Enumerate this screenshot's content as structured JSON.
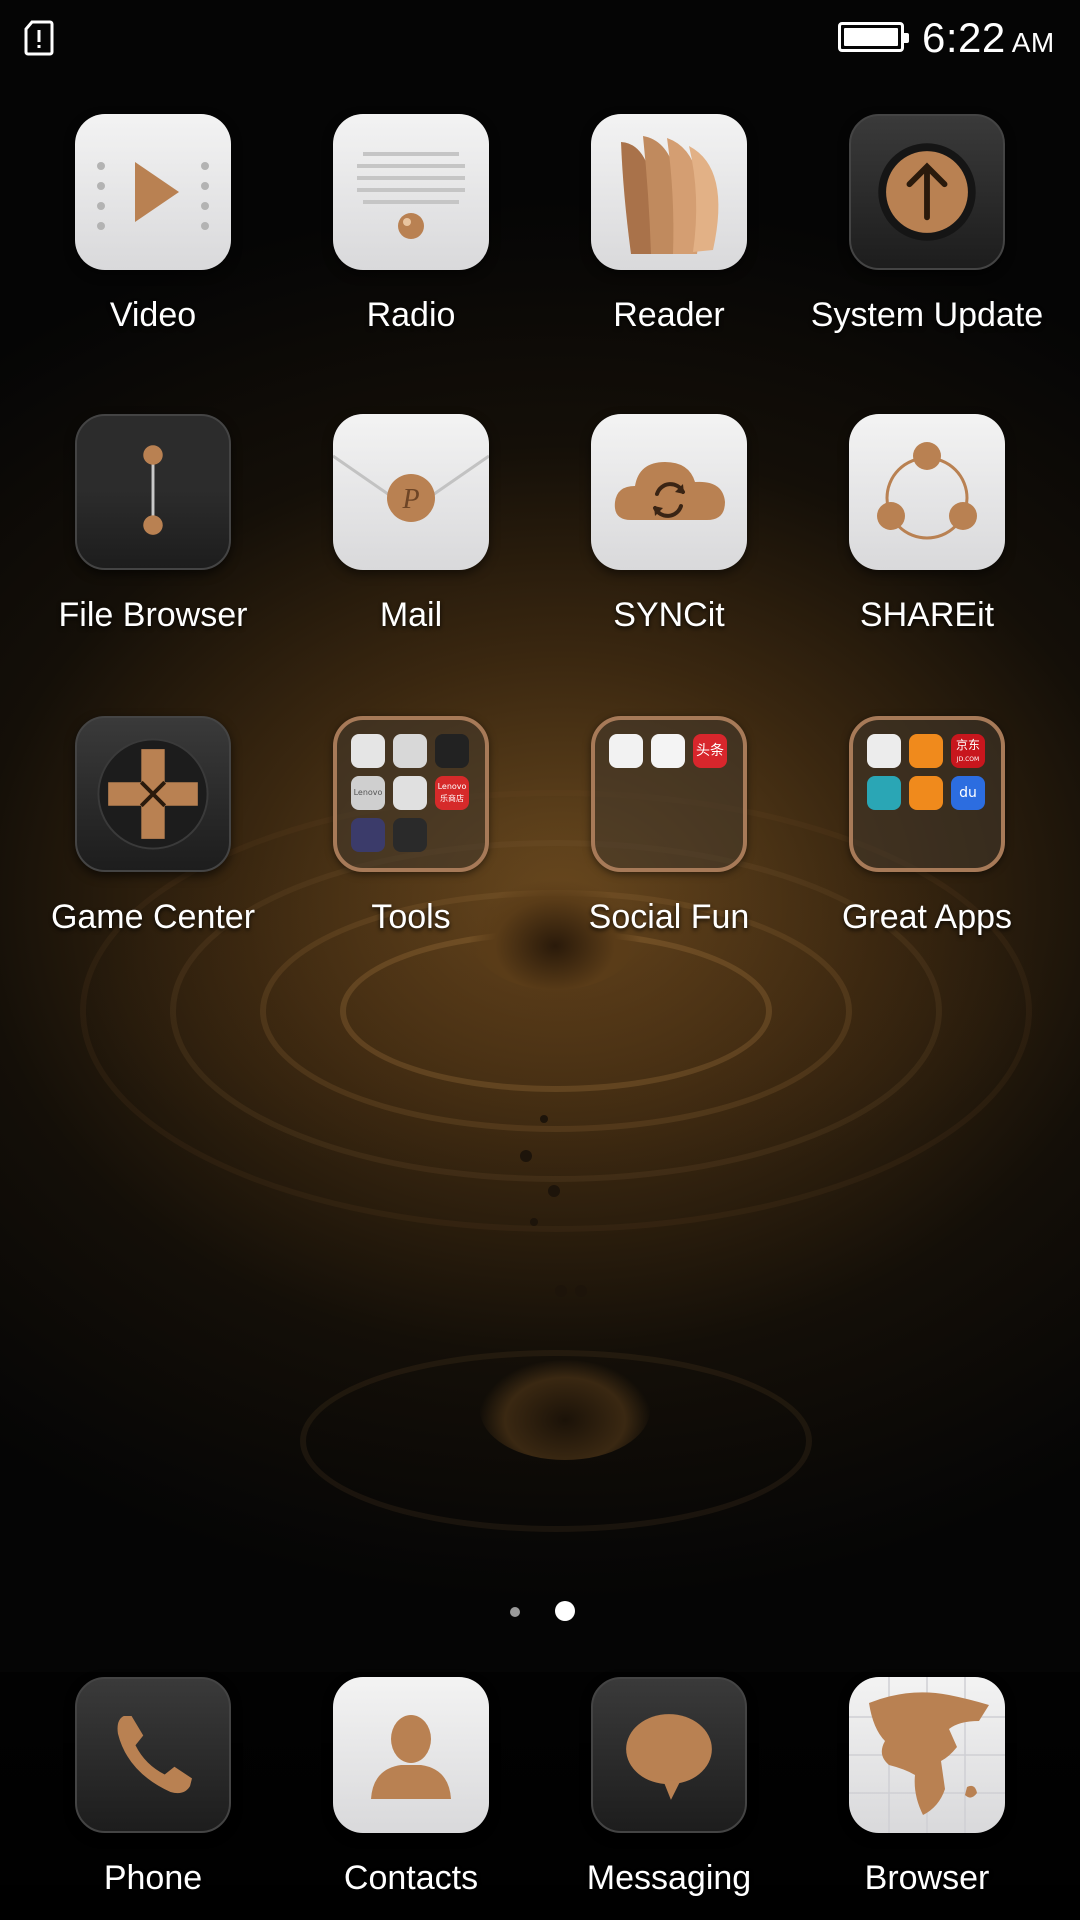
{
  "status_bar": {
    "sim_icon": "sim-alert-icon",
    "battery_icon": "battery-full-icon",
    "time": "6:22",
    "ampm": "AM"
  },
  "apps": [
    {
      "label": "Video",
      "icon": "video-play-icon"
    },
    {
      "label": "Radio",
      "icon": "radio-speaker-icon"
    },
    {
      "label": "Reader",
      "icon": "reader-pages-icon"
    },
    {
      "label": "System Update",
      "icon": "update-arrow-icon"
    },
    {
      "label": "File Browser",
      "icon": "file-browser-icon"
    },
    {
      "label": "Mail",
      "icon": "mail-envelope-icon"
    },
    {
      "label": "SYNCit",
      "icon": "sync-cloud-icon"
    },
    {
      "label": "SHAREit",
      "icon": "share-nodes-icon"
    },
    {
      "label": "Game Center",
      "icon": "gamepad-icon"
    }
  ],
  "folders": [
    {
      "label": "Tools",
      "icon": "tools-folder-icon",
      "mini_labels": [
        "Lenovo",
        "Lenovo",
        "乐商店"
      ]
    },
    {
      "label": "Social Fun",
      "icon": "social-folder-icon",
      "mini_labels": [
        "头条"
      ]
    },
    {
      "label": "Great Apps",
      "icon": "great-apps-folder-icon",
      "mini_labels": [
        "京东",
        "JD.COM",
        "du"
      ]
    }
  ],
  "page_indicator": {
    "count": 2,
    "active": 2
  },
  "dock": [
    {
      "label": "Phone",
      "icon": "phone-icon"
    },
    {
      "label": "Contacts",
      "icon": "contacts-icon"
    },
    {
      "label": "Messaging",
      "icon": "messaging-icon"
    },
    {
      "label": "Browser",
      "icon": "browser-globe-icon"
    }
  ],
  "colors": {
    "copper": "#b98152",
    "folder_border": "#a77a58"
  }
}
